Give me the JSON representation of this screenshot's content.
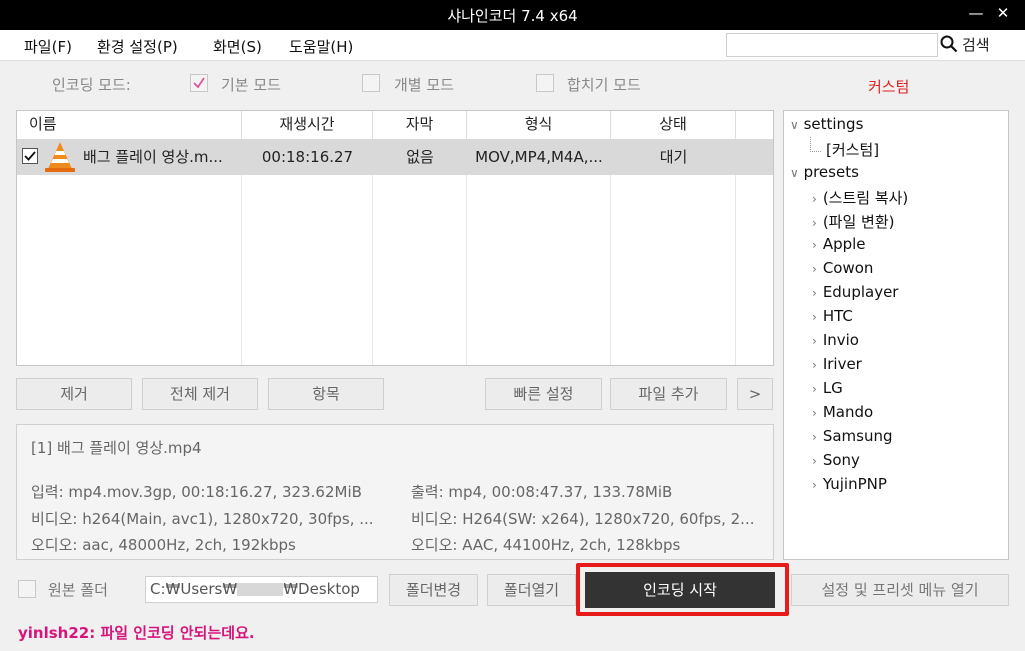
{
  "window": {
    "title": "샤나인코더  7.4 x64",
    "minimize": "—",
    "close": "✕"
  },
  "menu": {
    "items": [
      "파일(F)",
      "환경 설정(P)",
      "화면(S)",
      "도움말(H)"
    ],
    "search_label": "검색",
    "search_value": ""
  },
  "modes": {
    "label": "인코딩 모드:",
    "basic": "기본 모드",
    "individual": "개별 모드",
    "merge": "합치기 모드",
    "custom": "커스텀"
  },
  "list": {
    "headers": [
      "이름",
      "재생시간",
      "자막",
      "형식",
      "상태"
    ],
    "rows": [
      {
        "checked": true,
        "name": "배그 플레이 영상.m...",
        "duration": "00:18:16.27",
        "subtitle": "없음",
        "format": "MOV,MP4,M4A,...",
        "status": "대기"
      }
    ]
  },
  "buttons": {
    "remove": "제거",
    "remove_all": "전체 제거",
    "item": "항목",
    "quick_settings": "빠른 설정",
    "add_file": "파일 추가",
    "more": ">"
  },
  "info": {
    "title": "[1] 배그 플레이 영상.mp4",
    "input": "입력: mp4.mov.3gp, 00:18:16.27, 323.62MiB",
    "input_video": "비디오: h264(Main, avc1), 1280x720, 30fps, ...",
    "input_audio": "오디오: aac, 48000Hz, 2ch, 192kbps",
    "output": "출력: mp4, 00:08:47.37, 133.78MiB",
    "output_video": "비디오: H264(SW: x264), 1280x720, 60fps, 2...",
    "output_audio": "오디오: AAC, 44100Hz, 2ch, 128kbps"
  },
  "tree": {
    "settings": "settings",
    "custom": "[커스텀]",
    "presets": "presets",
    "preset_items": [
      "(스트림 복사)",
      "(파일 변환)",
      "Apple",
      "Cowon",
      "Eduplayer",
      "HTC",
      "Invio",
      "Iriver",
      "LG",
      "Mando",
      "Samsung",
      "Sony",
      "YujinPNP"
    ]
  },
  "bottom": {
    "source_folder": "원본 폴더",
    "path_start": "C:₩Users₩",
    "path_end": "₩Desktop",
    "change_folder": "폴더변경",
    "open_folder": "폴더열기",
    "start": "인코딩 시작",
    "settings_menu": "설정 및 프리셋 메뉴 열기"
  },
  "footer": {
    "message": "yinlsh22: 파일 인코딩 안되는데요."
  },
  "colors": {
    "highlight": "#e81b1b",
    "custom_label": "#e02020",
    "footer_text": "#d6157c",
    "check_pink": "#e0559a"
  }
}
